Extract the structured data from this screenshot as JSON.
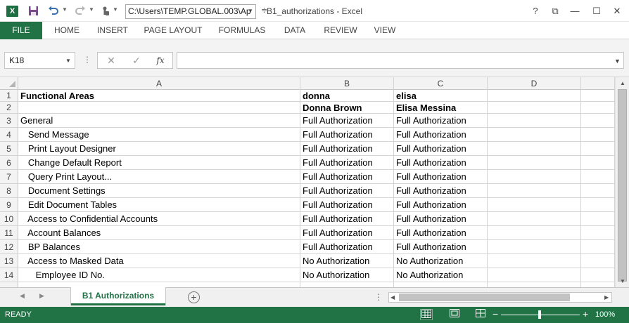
{
  "titlebar": {
    "app_icon": "X",
    "path": "C:\\Users\\TEMP.GLOBAL.003\\Ap",
    "title": "B1_authorizations - Excel",
    "help": "?",
    "ribbon_display": "⧉",
    "minimize": "—",
    "maximize": "☐",
    "close": "✕"
  },
  "ribbon": {
    "tabs": [
      "FILE",
      "HOME",
      "INSERT",
      "PAGE LAYOUT",
      "FORMULAS",
      "DATA",
      "REVIEW",
      "VIEW"
    ]
  },
  "formula_bar": {
    "name_box": "K18",
    "cancel": "✕",
    "enter": "✓",
    "fx": "fx",
    "formula": ""
  },
  "grid": {
    "columns": [
      "A",
      "B",
      "C",
      "D"
    ],
    "rows": [
      {
        "num": "1",
        "a": "Functional Areas",
        "b": "donna",
        "c": "elisa",
        "bold": true
      },
      {
        "num": "2",
        "a": "",
        "b": "Donna Brown",
        "c": "Elisa Messina",
        "bold": true
      },
      {
        "num": "3",
        "a": "General",
        "b": "Full Authorization",
        "c": "Full Authorization"
      },
      {
        "num": "4",
        "a": "   Send Message",
        "b": "Full Authorization",
        "c": "Full Authorization"
      },
      {
        "num": "5",
        "a": "   Print Layout Designer",
        "b": "Full Authorization",
        "c": "Full Authorization"
      },
      {
        "num": "6",
        "a": "   Change Default Report",
        "b": "Full Authorization",
        "c": "Full Authorization"
      },
      {
        "num": "7",
        "a": "   Query Print Layout...",
        "b": "Full Authorization",
        "c": "Full Authorization"
      },
      {
        "num": "8",
        "a": "   Document Settings",
        "b": "Full Authorization",
        "c": "Full Authorization"
      },
      {
        "num": "9",
        "a": "   Edit Document Tables",
        "b": "Full Authorization",
        "c": "Full Authorization"
      },
      {
        "num": "10",
        "a": "   Access to Confidential Accounts",
        "b": "Full Authorization",
        "c": "Full Authorization"
      },
      {
        "num": "11",
        "a": "   Account Balances",
        "b": "Full Authorization",
        "c": "Full Authorization"
      },
      {
        "num": "12",
        "a": "   BP Balances",
        "b": "Full Authorization",
        "c": "Full Authorization"
      },
      {
        "num": "13",
        "a": "   Access to Masked Data",
        "b": "No Authorization",
        "c": "No Authorization"
      },
      {
        "num": "14",
        "a": "      Employee ID No.",
        "b": "No Authorization",
        "c": "No Authorization"
      }
    ]
  },
  "sheets": {
    "active": "B1 Authorizations",
    "add": "+"
  },
  "status": {
    "text": "READY",
    "zoom_minus": "−",
    "zoom_plus": "+",
    "zoom": "100%",
    "zoom_level_percent": 100
  },
  "colors": {
    "excel_green": "#217346",
    "status_green": "#217346",
    "header_gray": "#f3f3f3",
    "gridline": "#d4d4d4"
  },
  "icons": {
    "save": "save-icon",
    "undo": "undo-icon",
    "redo": "redo-icon",
    "touch": "touch-mode-icon",
    "normal_view": "normal-view-icon",
    "page_layout_view": "page-layout-view-icon",
    "page_break_view": "page-break-view-icon"
  }
}
